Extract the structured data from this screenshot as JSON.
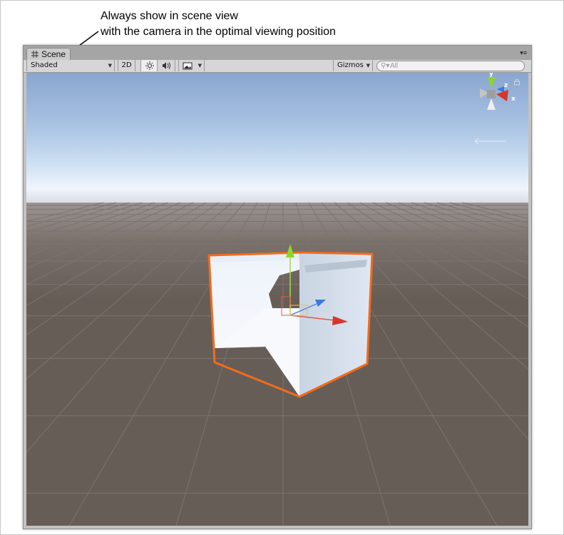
{
  "annotation": {
    "line1": "Always show in scene view",
    "line2": "with the camera in the optimal viewing position"
  },
  "window": {
    "tab_label": "Scene",
    "tab_icon": "grid-icon",
    "menu_icon": "tab-menu-icon"
  },
  "toolbar": {
    "draw_mode": "Shaded",
    "toggle_2d": "2D",
    "lighting_icon": "sun-icon",
    "audio_icon": "speaker-icon",
    "effects_icon": "image-icon",
    "gizmos_label": "Gizmos",
    "search_placeholder": "All",
    "search_icon": "search-icon"
  },
  "scene_gizmo": {
    "axis_y": "y",
    "axis_z": "z",
    "axis_x": "x",
    "colors": {
      "x": "#d6362a",
      "y": "#8ed52b",
      "z": "#3b78e0"
    }
  },
  "selection_color": "#f26b1d"
}
